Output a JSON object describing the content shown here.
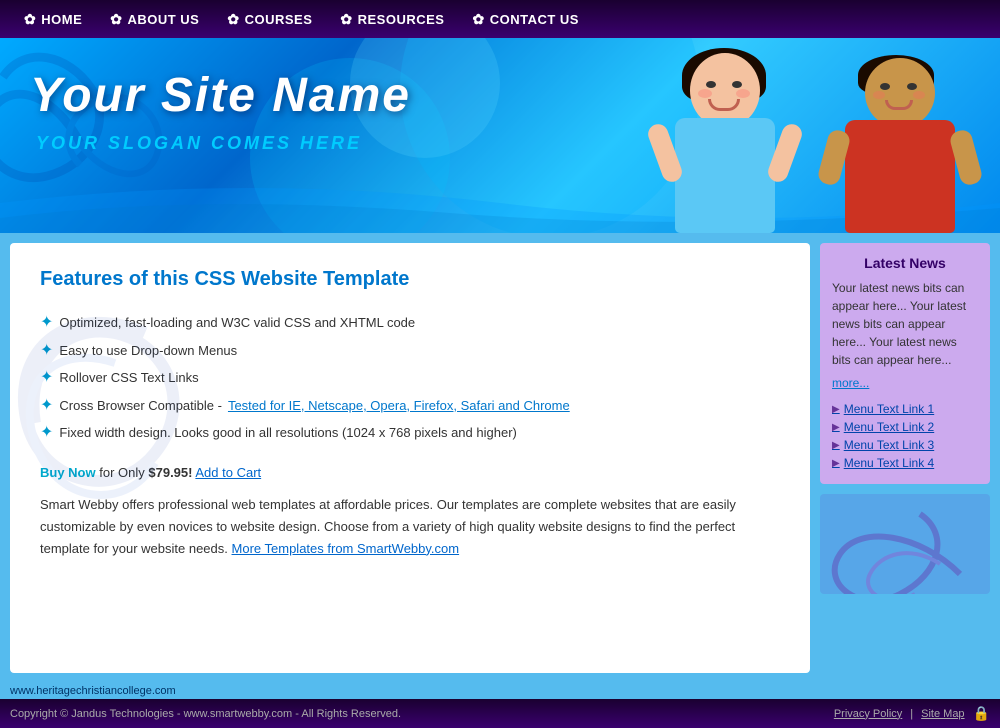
{
  "nav": {
    "items": [
      {
        "label": "HOME",
        "icon": "✿",
        "id": "home"
      },
      {
        "label": "ABOUT US",
        "icon": "✿",
        "id": "about-us"
      },
      {
        "label": "COURSES",
        "icon": "✿",
        "id": "courses"
      },
      {
        "label": "RESOURCES",
        "icon": "✿",
        "id": "resources"
      },
      {
        "label": "CONTACT US",
        "icon": "✿",
        "id": "contact-us"
      }
    ]
  },
  "header": {
    "site_name": "Your Site Name",
    "slogan": "Your Slogan Comes Here"
  },
  "content": {
    "heading": "Features of this CSS Website Template",
    "features": [
      "Optimized, fast-loading and W3C valid CSS and XHTML code",
      "Easy to use Drop-down Menus",
      "Rollover CSS Text Links",
      "Cross Browser Compatible - Tested for IE, Netscape, Opera, Firefox, Safari and Chrome",
      "Fixed width design. Looks good in all resolutions (1024 x 768 pixels and higher)"
    ],
    "feature_link_prefix": "Cross Browser Compatible - ",
    "feature_link_text": "Tested for IE, Netscape, Opera, Firefox, Safari and Chrome",
    "buy_now_label": "Buy Now",
    "buy_now_prefix": "",
    "buy_now_middle": " for Only ",
    "buy_now_price": "$79.95!",
    "buy_now_suffix": " ",
    "add_to_cart": "Add to Cart",
    "description": "Smart Webby offers professional web templates at affordable prices. Our templates are complete websites that are easily customizable by even novices to website design. Choose from a variety of high quality website designs to find the perfect template for your website needs.",
    "more_templates_link": "More Templates from SmartWebby.com"
  },
  "sidebar": {
    "news_heading": "Latest News",
    "news_text": "Your latest news bits can appear here... Your latest news bits can appear here... Your latest news bits can appear here...",
    "news_more": "more...",
    "links": [
      {
        "label": "Menu Text Link 1"
      },
      {
        "label": "Menu Text Link 2"
      },
      {
        "label": "Menu Text Link 3"
      },
      {
        "label": "Menu Text Link 4"
      }
    ]
  },
  "footer": {
    "url": "www.heritagechristiancollege.com",
    "copyright": "Copyright © Jandus Technologies - www.smartwebby.com - All Rights Reserved.",
    "privacy_policy": "Privacy Policy",
    "site_map": "Site Map",
    "divider": "|"
  }
}
